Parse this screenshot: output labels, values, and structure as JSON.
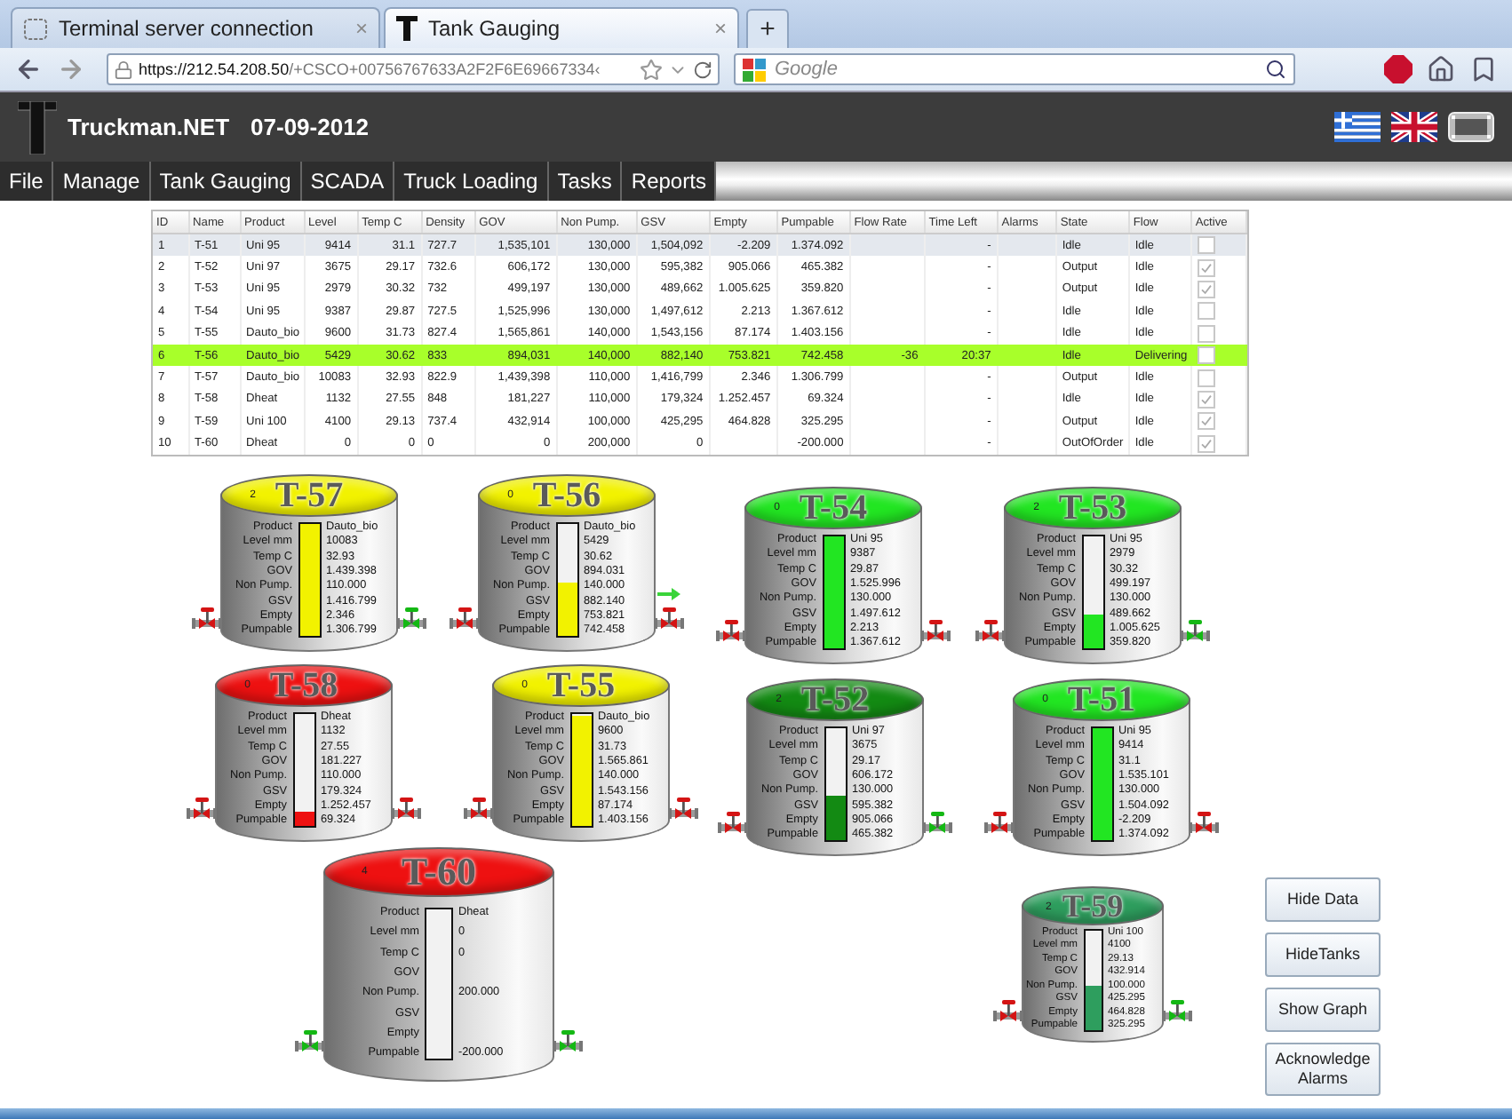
{
  "browser": {
    "tabs": [
      {
        "title": "Terminal server connection",
        "close": "×",
        "selected": false
      },
      {
        "title": "Tank Gauging",
        "close": "×",
        "selected": true
      }
    ],
    "new_tab": "+",
    "url_host": "https://212.54.208.50",
    "url_path": "/+CSCO+00756767633A2F2F6E69667334‹",
    "search": {
      "placeholder": "Google"
    }
  },
  "app": {
    "title": "Truckman.NET",
    "date": "07-09-2012"
  },
  "menu": [
    "File",
    "Manage",
    "Tank Gauging",
    "SCADA",
    "Truck Loading",
    "Tasks",
    "Reports"
  ],
  "table": {
    "columns": [
      {
        "label": "ID",
        "kind": "text"
      },
      {
        "label": "Name",
        "kind": "text"
      },
      {
        "label": "Product",
        "kind": "text"
      },
      {
        "label": "Level",
        "kind": "number"
      },
      {
        "label": "Temp C",
        "kind": "number"
      },
      {
        "label": "Density",
        "kind": "text"
      },
      {
        "label": "GOV",
        "kind": "number"
      },
      {
        "label": "Non Pump.",
        "kind": "number"
      },
      {
        "label": "GSV",
        "kind": "number"
      },
      {
        "label": "Empty",
        "kind": "number"
      },
      {
        "label": "Pumpable",
        "kind": "number"
      },
      {
        "label": "Flow Rate",
        "kind": "number"
      },
      {
        "label": "Time Left",
        "kind": "number"
      },
      {
        "label": "Alarms",
        "kind": "text"
      },
      {
        "label": "State",
        "kind": "text"
      },
      {
        "label": "Flow",
        "kind": "text"
      },
      {
        "label": "Active",
        "kind": "check"
      }
    ],
    "rows": [
      {
        "selected": true,
        "highlight": false,
        "cells": [
          "1",
          "T-51",
          "Uni 95",
          "9414",
          "31.1",
          "727.7",
          "1,535,101",
          "130,000",
          "1,504,092",
          "-2.209",
          "1.374.092",
          null,
          "-",
          null,
          "Idle",
          "Idle"
        ],
        "active": false
      },
      {
        "selected": false,
        "highlight": false,
        "cells": [
          "2",
          "T-52",
          "Uni 97",
          "3675",
          "29.17",
          "732.6",
          "606,172",
          "130,000",
          "595,382",
          "905.066",
          "465.382",
          null,
          "-",
          null,
          "Output",
          "Idle"
        ],
        "active": true
      },
      {
        "selected": false,
        "highlight": false,
        "cells": [
          "3",
          "T-53",
          "Uni 95",
          "2979",
          "30.32",
          "732",
          "499,197",
          "130,000",
          "489,662",
          "1.005.625",
          "359.820",
          null,
          "-",
          null,
          "Output",
          "Idle"
        ],
        "active": true
      },
      {
        "selected": false,
        "highlight": false,
        "cells": [
          "4",
          "T-54",
          "Uni 95",
          "9387",
          "29.87",
          "727.5",
          "1,525,996",
          "130,000",
          "1,497,612",
          "2.213",
          "1.367.612",
          null,
          "-",
          null,
          "Idle",
          "Idle"
        ],
        "active": false
      },
      {
        "selected": false,
        "highlight": false,
        "cells": [
          "5",
          "T-55",
          "Dauto_bio",
          "9600",
          "31.73",
          "827.4",
          "1,565,861",
          "140,000",
          "1,543,156",
          "87.174",
          "1.403.156",
          null,
          "-",
          null,
          "Idle",
          "Idle"
        ],
        "active": false
      },
      {
        "selected": false,
        "highlight": true,
        "cells": [
          "6",
          "T-56",
          "Dauto_bio",
          "5429",
          "30.62",
          "833",
          "894,031",
          "140,000",
          "882,140",
          "753.821",
          "742.458",
          "-36",
          "20:37",
          null,
          "Idle",
          "Delivering"
        ],
        "active": false
      },
      {
        "selected": false,
        "highlight": false,
        "cells": [
          "7",
          "T-57",
          "Dauto_bio",
          "10083",
          "32.93",
          "822.9",
          "1,439,398",
          "110,000",
          "1,416,799",
          "2.346",
          "1.306.799",
          null,
          "-",
          null,
          "Output",
          "Idle"
        ],
        "active": false
      },
      {
        "selected": false,
        "highlight": false,
        "cells": [
          "8",
          "T-58",
          "Dheat",
          "1132",
          "27.55",
          "848",
          "181,227",
          "110,000",
          "179,324",
          "1.252.457",
          "69.324",
          null,
          "-",
          null,
          "Idle",
          "Idle"
        ],
        "active": true
      },
      {
        "selected": false,
        "highlight": false,
        "cells": [
          "9",
          "T-59",
          "Uni 100",
          "4100",
          "29.13",
          "737.4",
          "432,914",
          "100,000",
          "425,295",
          "464.828",
          "325.295",
          null,
          "-",
          null,
          "Output",
          "Idle"
        ],
        "active": true
      },
      {
        "selected": false,
        "highlight": false,
        "cells": [
          "10",
          "T-60",
          "Dheat",
          "0",
          "0",
          "0",
          "0",
          "200,000",
          "0",
          null,
          "-200.000",
          null,
          "-",
          null,
          "OutOfOrder",
          "Idle"
        ],
        "active": true
      }
    ]
  },
  "tanks": [
    {
      "name": "T-57",
      "alarms": "2",
      "color": "#f2f200",
      "level": 1.0,
      "left_valve_open": false,
      "right_valve_open": true,
      "outflow": false,
      "fields": [
        {
          "label": "Product",
          "value": "Dauto_bio"
        },
        {
          "label": "Level mm",
          "value": "10083"
        },
        {
          "label": "Temp C",
          "value": "32.93"
        },
        {
          "label": "GOV",
          "value": "1.439.398"
        },
        {
          "label": "Non Pump.",
          "value": "110.000"
        },
        {
          "label": "GSV",
          "value": "1.416.799"
        },
        {
          "label": "Empty",
          "value": "2.346"
        },
        {
          "label": "Pumpable",
          "value": "1.306.799"
        }
      ]
    },
    {
      "name": "T-56",
      "alarms": "0",
      "color": "#f2f200",
      "level": 0.47,
      "left_valve_open": false,
      "right_valve_open": false,
      "outflow": true,
      "fields": [
        {
          "label": "Product",
          "value": "Dauto_bio"
        },
        {
          "label": "Level mm",
          "value": "5429"
        },
        {
          "label": "Temp C",
          "value": "30.62"
        },
        {
          "label": "GOV",
          "value": "894.031"
        },
        {
          "label": "Non Pump.",
          "value": "140.000"
        },
        {
          "label": "GSV",
          "value": "882.140"
        },
        {
          "label": "Empty",
          "value": "753.821"
        },
        {
          "label": "Pumpable",
          "value": "742.458"
        }
      ]
    },
    {
      "name": "T-54",
      "alarms": "0",
      "color": "#22e622",
      "level": 1.0,
      "left_valve_open": false,
      "right_valve_open": false,
      "outflow": false,
      "fields": [
        {
          "label": "Product",
          "value": "Uni 95"
        },
        {
          "label": "Level mm",
          "value": "9387"
        },
        {
          "label": "Temp C",
          "value": "29.87"
        },
        {
          "label": "GOV",
          "value": "1.525.996"
        },
        {
          "label": "Non Pump.",
          "value": "130.000"
        },
        {
          "label": "GSV",
          "value": "1.497.612"
        },
        {
          "label": "Empty",
          "value": "2.213"
        },
        {
          "label": "Pumpable",
          "value": "1.367.612"
        }
      ]
    },
    {
      "name": "T-53",
      "alarms": "2",
      "color": "#22e622",
      "level": 0.3,
      "left_valve_open": false,
      "right_valve_open": true,
      "outflow": false,
      "fields": [
        {
          "label": "Product",
          "value": "Uni 95"
        },
        {
          "label": "Level mm",
          "value": "2979"
        },
        {
          "label": "Temp C",
          "value": "30.32"
        },
        {
          "label": "GOV",
          "value": "499.197"
        },
        {
          "label": "Non Pump.",
          "value": "130.000"
        },
        {
          "label": "GSV",
          "value": "489.662"
        },
        {
          "label": "Empty",
          "value": "1.005.625"
        },
        {
          "label": "Pumpable",
          "value": "359.820"
        }
      ]
    },
    {
      "name": "T-58",
      "alarms": "0",
      "color": "#ee1111",
      "level": 0.12,
      "left_valve_open": false,
      "right_valve_open": false,
      "outflow": false,
      "fields": [
        {
          "label": "Product",
          "value": "Dheat"
        },
        {
          "label": "Level mm",
          "value": "1132"
        },
        {
          "label": "Temp C",
          "value": "27.55"
        },
        {
          "label": "GOV",
          "value": "181.227"
        },
        {
          "label": "Non Pump.",
          "value": "110.000"
        },
        {
          "label": "GSV",
          "value": "179.324"
        },
        {
          "label": "Empty",
          "value": "1.252.457"
        },
        {
          "label": "Pumpable",
          "value": "69.324"
        }
      ]
    },
    {
      "name": "T-55",
      "alarms": "0",
      "color": "#f2f200",
      "level": 0.98,
      "left_valve_open": false,
      "right_valve_open": false,
      "outflow": false,
      "fields": [
        {
          "label": "Product",
          "value": "Dauto_bio"
        },
        {
          "label": "Level mm",
          "value": "9600"
        },
        {
          "label": "Temp C",
          "value": "31.73"
        },
        {
          "label": "GOV",
          "value": "1.565.861"
        },
        {
          "label": "Non Pump.",
          "value": "140.000"
        },
        {
          "label": "GSV",
          "value": "1.543.156"
        },
        {
          "label": "Empty",
          "value": "87.174"
        },
        {
          "label": "Pumpable",
          "value": "1.403.156"
        }
      ]
    },
    {
      "name": "T-52",
      "alarms": "2",
      "color": "#138a13",
      "level": 0.4,
      "left_valve_open": false,
      "right_valve_open": true,
      "outflow": false,
      "fields": [
        {
          "label": "Product",
          "value": "Uni 97"
        },
        {
          "label": "Level mm",
          "value": "3675"
        },
        {
          "label": "Temp C",
          "value": "29.17"
        },
        {
          "label": "GOV",
          "value": "606.172"
        },
        {
          "label": "Non Pump.",
          "value": "130.000"
        },
        {
          "label": "GSV",
          "value": "595.382"
        },
        {
          "label": "Empty",
          "value": "905.066"
        },
        {
          "label": "Pumpable",
          "value": "465.382"
        }
      ]
    },
    {
      "name": "T-51",
      "alarms": "0",
      "color": "#22e622",
      "level": 1.0,
      "left_valve_open": false,
      "right_valve_open": false,
      "outflow": false,
      "fields": [
        {
          "label": "Product",
          "value": "Uni 95"
        },
        {
          "label": "Level mm",
          "value": "9414"
        },
        {
          "label": "Temp C",
          "value": "31.1"
        },
        {
          "label": "GOV",
          "value": "1.535.101"
        },
        {
          "label": "Non Pump.",
          "value": "130.000"
        },
        {
          "label": "GSV",
          "value": "1.504.092"
        },
        {
          "label": "Empty",
          "value": "-2.209"
        },
        {
          "label": "Pumpable",
          "value": "1.374.092"
        }
      ]
    },
    {
      "name": "T-60",
      "alarms": "4",
      "color": "#ee1111",
      "level": 0,
      "left_valve_open": true,
      "right_valve_open": true,
      "outflow": false,
      "fields": [
        {
          "label": "Product",
          "value": "Dheat"
        },
        {
          "label": "Level mm",
          "value": "0"
        },
        {
          "label": "Temp C",
          "value": "0"
        },
        {
          "label": "GOV"
        },
        {
          "label": "Non Pump.",
          "value": "200.000"
        },
        {
          "label": "GSV"
        },
        {
          "label": "Empty"
        },
        {
          "label": "Pumpable",
          "value": "-200.000"
        }
      ]
    },
    {
      "name": "T-59",
      "alarms": "2",
      "color": "#2e9e5e",
      "level": 0.45,
      "left_valve_open": false,
      "right_valve_open": true,
      "outflow": false,
      "fields": [
        {
          "label": "Product",
          "value": "Uni 100"
        },
        {
          "label": "Level mm",
          "value": "4100"
        },
        {
          "label": "Temp C",
          "value": "29.13"
        },
        {
          "label": "GOV",
          "value": "432.914"
        },
        {
          "label": "Non Pump.",
          "value": "100.000"
        },
        {
          "label": "GSV",
          "value": "425.295"
        },
        {
          "label": "Empty",
          "value": "464.828"
        },
        {
          "label": "Pumpable",
          "value": "325.295"
        }
      ]
    }
  ],
  "buttons": [
    "Hide Data",
    "HideTanks",
    "Show Graph",
    "Acknowledge Alarms"
  ]
}
